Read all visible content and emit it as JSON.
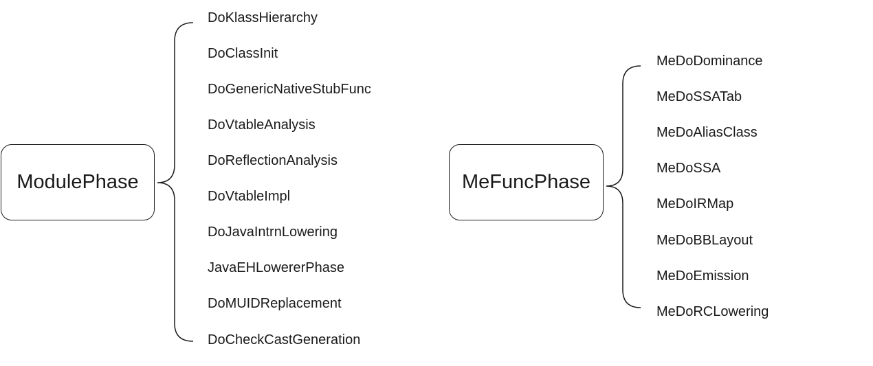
{
  "groups": [
    {
      "root": "ModulePhase",
      "items": [
        "DoKlassHierarchy",
        "DoClassInit",
        "DoGenericNativeStubFunc",
        "DoVtableAnalysis",
        "DoReflectionAnalysis",
        "DoVtableImpl",
        "DoJavaIntrnLowering",
        "JavaEHLowererPhase",
        "DoMUIDReplacement",
        "DoCheckCastGeneration"
      ]
    },
    {
      "root": "MeFuncPhase",
      "items": [
        "MeDoDominance",
        "MeDoSSATab",
        "MeDoAliasClass",
        "MeDoSSA",
        "MeDoIRMap",
        "MeDoBBLayout",
        "MeDoEmission",
        "MeDoRCLowering"
      ]
    }
  ]
}
